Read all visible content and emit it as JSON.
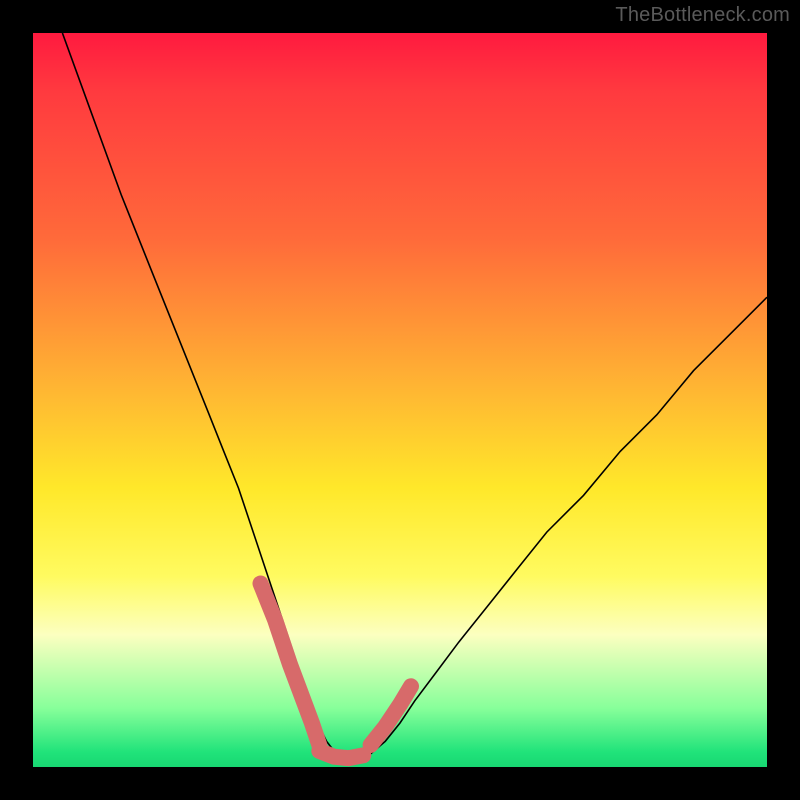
{
  "attribution": "TheBottleneck.com",
  "colors": {
    "background": "#000000",
    "watermark": "#5a5a5a",
    "curve": "#000000",
    "bumps": "#d76a6a",
    "gradient_stops": [
      "#ff1a3f",
      "#ff3a3f",
      "#ff6a3a",
      "#ffb433",
      "#ffe82a",
      "#fffb60",
      "#fcffc0",
      "#87ff9a",
      "#20e37a",
      "#18d772"
    ]
  },
  "chart_data": {
    "type": "line",
    "title": "",
    "xlabel": "",
    "ylabel": "",
    "xlim": [
      0,
      100
    ],
    "ylim": [
      0,
      100
    ],
    "legend": false,
    "grid": false,
    "series": [
      {
        "name": "curve",
        "x": [
          4,
          8,
          12,
          16,
          20,
          24,
          26,
          28,
          30,
          32,
          34,
          35,
          36,
          37,
          38,
          39,
          40,
          41,
          42,
          43,
          44,
          45,
          46,
          48,
          50,
          52,
          55,
          58,
          62,
          66,
          70,
          75,
          80,
          85,
          90,
          95,
          100
        ],
        "y": [
          100,
          89,
          78,
          68,
          58,
          48,
          43,
          38,
          32,
          26,
          20,
          17,
          14,
          11,
          8,
          5.5,
          3.5,
          2.2,
          1.4,
          1.0,
          1.0,
          1.2,
          1.8,
          3.5,
          6,
          9,
          13,
          17,
          22,
          27,
          32,
          37,
          43,
          48,
          54,
          59,
          64
        ]
      }
    ],
    "annotations": [
      {
        "name": "left-bumps",
        "type": "polyline",
        "x": [
          31,
          33,
          35,
          36.5,
          38,
          39
        ],
        "y": [
          25,
          20,
          14,
          10,
          6,
          3
        ]
      },
      {
        "name": "floor-bumps",
        "type": "polyline",
        "x": [
          39,
          41,
          43,
          45
        ],
        "y": [
          2.2,
          1.4,
          1.2,
          1.6
        ]
      },
      {
        "name": "right-bumps",
        "type": "polyline",
        "x": [
          46,
          48,
          50,
          51.5
        ],
        "y": [
          3,
          5.5,
          8.5,
          11
        ]
      }
    ]
  }
}
